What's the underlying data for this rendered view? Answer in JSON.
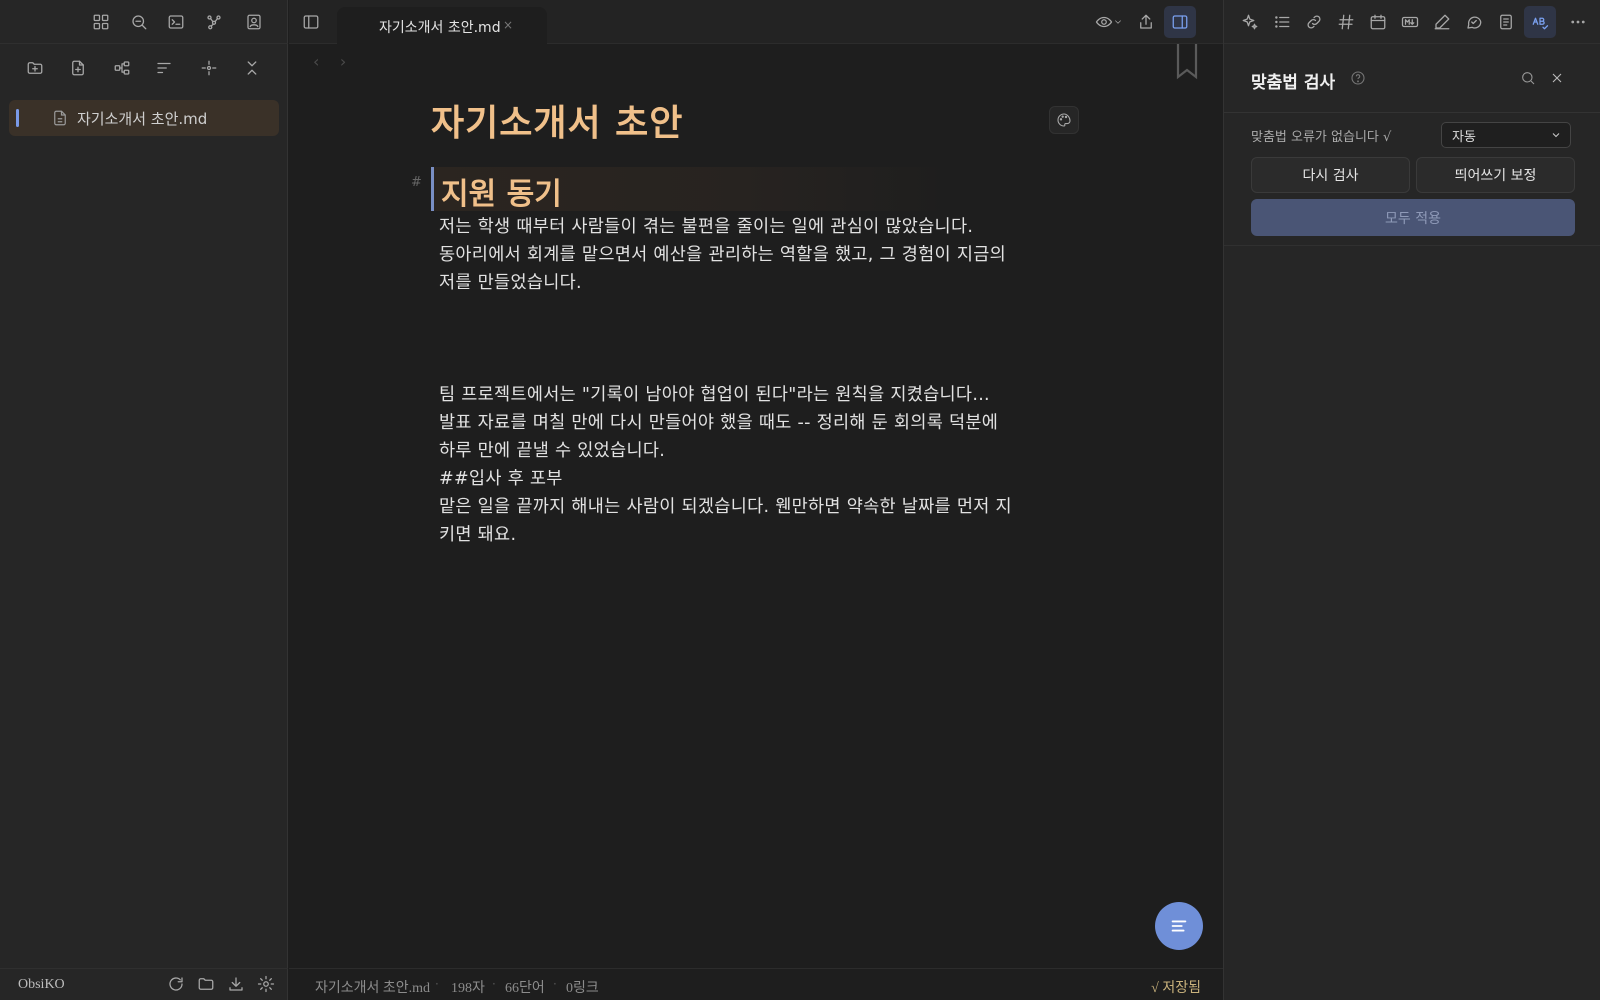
{
  "tab": {
    "title": "자기소개서 초안.md",
    "close": "×"
  },
  "file_tree": {
    "items": [
      {
        "label": "자기소개서 초안.md"
      }
    ]
  },
  "vault": {
    "name": "ObsiKO"
  },
  "editor": {
    "nav_back": "‹",
    "nav_forward": "›",
    "title": "자기소개서 초안",
    "heading_marker": "#",
    "heading": "지원 동기",
    "lines": [
      "저는 학생 때부터 사람들이 겪는 불편을 줄이는 일에 관심이 많았습니다.",
      "동아리에서 회계를 맡으면서 예산을 관리하는 역할을 했고, 그 경험이 지금의",
      "저를 만들었습니다.",
      "팀 프로젝트에서는 \"기록이 남아야 협업이 된다\"라는 원칙을 지켰습니다...",
      "발표 자료를 며칠 만에 다시 만들어야 했을 때도 -- 정리해 둔 회의록 덕분에",
      "하루 만에 끝낼 수 있었습니다.",
      "##입사 후 포부",
      "맡은 일을 끝까지 해내는 사람이 되겠습니다. 웬만하면 약속한 날짜를 먼저 지",
      "키면 돼요."
    ]
  },
  "status_bar": {
    "file": "자기소개서 초안.md",
    "chars": "198자",
    "words": "66단어",
    "links": "0링크",
    "saved": "√ 저장됨",
    "separator": "·"
  },
  "spell_panel": {
    "title": "맞춤법 검사",
    "status": "맞춤법 오류가 없습니다 √",
    "mode_selected": "자동",
    "recheck_label": "다시 검사",
    "spacing_label": "띄어쓰기 보정",
    "apply_all_label": "모두 적용"
  },
  "icons": {
    "left_ribbon": [
      "dashboard-icon",
      "search-icon",
      "terminal-icon",
      "graph-icon",
      "user-card-icon"
    ],
    "file_toolbar": [
      "new-folder-icon",
      "new-note-icon",
      "tree-view-icon",
      "sort-icon",
      "focus-icon",
      "collapse-icon"
    ],
    "right_toolbar": [
      "sparkle-icon",
      "list-icon",
      "link-icon",
      "tag-icon",
      "calendar-icon",
      "markdown-icon",
      "pen-icon",
      "chat-icon",
      "note-icon",
      "spellcheck-icon",
      "more-icon"
    ]
  },
  "colors": {
    "accent": "#7a9ae8",
    "heading": "#f0c08a",
    "saved": "#c9b27c",
    "fab": "#6f8fd8"
  }
}
